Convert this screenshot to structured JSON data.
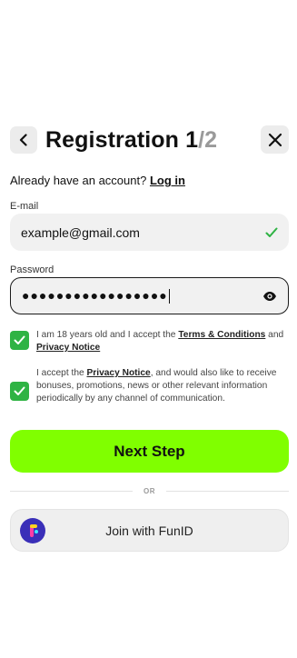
{
  "header": {
    "title": "Registration 1",
    "step_total": "/2"
  },
  "login_prompt": {
    "text": "Already have an account? ",
    "link": "Log in"
  },
  "email": {
    "label": "E-mail",
    "value": "example@gmail.com"
  },
  "password": {
    "label": "Password",
    "value": "●●●●●●●●●●●●●●●●●"
  },
  "consents": {
    "terms": {
      "text_before": "I am 18 years old and I accept the ",
      "link1": "Terms & Conditions",
      "text_middle": " and ",
      "link2": "Privacy Notice",
      "checked": true
    },
    "marketing": {
      "text_before": "I accept the ",
      "link": "Privacy Notice",
      "text_after": ", and would also like to receive bonuses, promotions, news or other relevant information periodically by any channel of communication.",
      "checked": true
    }
  },
  "next_button": {
    "label": "Next Step"
  },
  "divider": {
    "label": "OR"
  },
  "funid_button": {
    "label": "Join with FunID"
  },
  "colors": {
    "primary": "#80ff00",
    "checkbox": "#2fb344",
    "valid_check": "#2fb344",
    "funid_logo": "#3a2fb8"
  },
  "icons": {
    "back": "chevron-left-icon",
    "close": "close-icon",
    "valid": "checkmark-icon",
    "visibility": "eye-icon",
    "funid": "funid-logo-icon"
  }
}
